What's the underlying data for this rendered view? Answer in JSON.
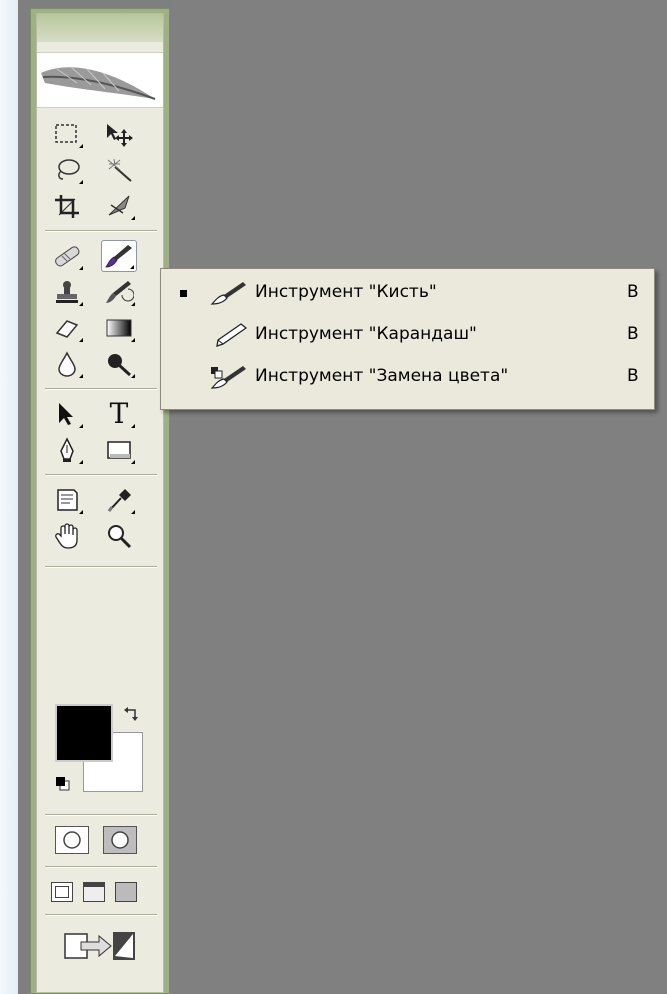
{
  "toolbox": {
    "tools": [
      {
        "id": "marquee",
        "icon": "rect-marquee-icon"
      },
      {
        "id": "move",
        "icon": "move-icon"
      },
      {
        "id": "lasso",
        "icon": "lasso-icon"
      },
      {
        "id": "magic-wand",
        "icon": "magic-wand-icon"
      },
      {
        "id": "crop",
        "icon": "crop-icon"
      },
      {
        "id": "slice",
        "icon": "slice-icon"
      },
      {
        "id": "healing",
        "icon": "healing-brush-icon"
      },
      {
        "id": "brush",
        "icon": "brush-icon",
        "selected": true
      },
      {
        "id": "stamp",
        "icon": "clone-stamp-icon"
      },
      {
        "id": "history-brush",
        "icon": "history-brush-icon"
      },
      {
        "id": "eraser",
        "icon": "eraser-icon"
      },
      {
        "id": "gradient",
        "icon": "gradient-icon"
      },
      {
        "id": "blur",
        "icon": "blur-drop-icon"
      },
      {
        "id": "dodge",
        "icon": "dodge-icon"
      },
      {
        "id": "path-select",
        "icon": "path-selection-icon"
      },
      {
        "id": "type",
        "icon": "type-icon"
      },
      {
        "id": "pen",
        "icon": "pen-icon"
      },
      {
        "id": "shape",
        "icon": "rectangle-shape-icon"
      },
      {
        "id": "notes",
        "icon": "notes-icon"
      },
      {
        "id": "eyedropper",
        "icon": "eyedropper-icon"
      },
      {
        "id": "hand",
        "icon": "hand-icon"
      },
      {
        "id": "zoom",
        "icon": "zoom-icon"
      }
    ],
    "type_glyph": "T",
    "foreground_color": "#000000",
    "background_color": "#ffffff"
  },
  "flyout_menu": {
    "items": [
      {
        "label": "Инструмент \"Кисть\"",
        "shortcut": "B",
        "active": true,
        "icon": "brush-icon"
      },
      {
        "label": "Инструмент \"Карандаш\"",
        "shortcut": "B",
        "active": false,
        "icon": "pencil-icon"
      },
      {
        "label": "Инструмент \"Замена цвета\"",
        "shortcut": "B",
        "active": false,
        "icon": "color-replacement-icon"
      }
    ]
  }
}
